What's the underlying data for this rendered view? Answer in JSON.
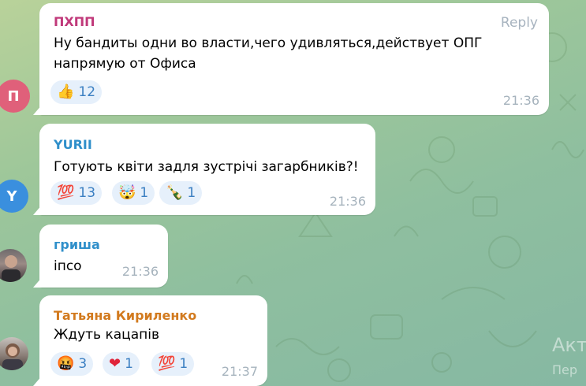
{
  "messages": [
    {
      "author": "ПХПП",
      "reply_label": "Reply",
      "lines": [
        "Ну бандиты одни во власти,чего удивляться,действует ОПГ",
        "напрямую от  Офиса"
      ],
      "reactions": [
        {
          "icon": "thumbs-up-icon",
          "glyph": "👍",
          "count": "12"
        }
      ],
      "time": "21:36",
      "avatar_letter": "П",
      "avatar_color": "#e0607a"
    },
    {
      "author": "YURII",
      "lines": [
        "Готують квіти задля зустрічі загарбників?!"
      ],
      "reactions": [
        {
          "icon": "hundred-points-icon",
          "glyph": "💯",
          "count": "13"
        },
        {
          "icon": "exploding-head-icon",
          "glyph": "🤯",
          "count": "1"
        },
        {
          "icon": "champagne-icon",
          "glyph": "🍾",
          "count": "1"
        }
      ],
      "time": "21:36",
      "avatar_letter": "Y",
      "avatar_color": "#3a8fde"
    },
    {
      "author": "гриша",
      "lines": [
        "іпсо"
      ],
      "time": "21:36"
    },
    {
      "author": "Татьяна Кириленко",
      "lines": [
        "Ждуть кацапів"
      ],
      "reactions": [
        {
          "icon": "angry-face-icon",
          "glyph": "🤬",
          "count": "3"
        },
        {
          "icon": "red-heart-icon",
          "glyph": "❤",
          "count": "1"
        },
        {
          "icon": "hundred-points-icon",
          "glyph": "💯",
          "count": "1"
        }
      ],
      "time": "21:37"
    }
  ],
  "colors": {
    "author1": "#c0397a",
    "author2": "#2f8fca",
    "author3": "#2f8fca",
    "author4": "#d27a1e"
  },
  "watermark": [
    "Акт",
    "Пер"
  ]
}
